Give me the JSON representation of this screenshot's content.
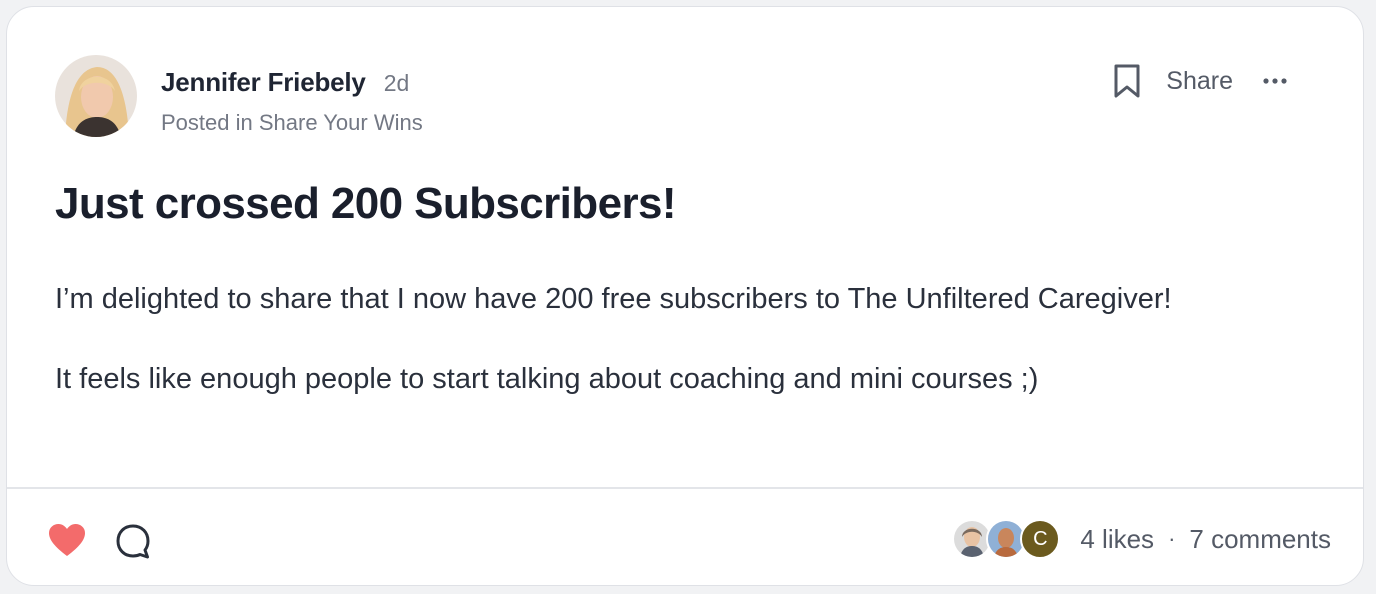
{
  "post": {
    "author_name": "Jennifer Friebely",
    "age": "2d",
    "posted_in_prefix": "Posted in",
    "space_name": "Share Your Wins",
    "share_label": "Share",
    "title": "Just crossed 200 Subscribers!",
    "paragraphs": [
      "I’m delighted to share that I now have 200 free subscribers to The Unfiltered Caregiver!",
      "It feels like enough people to start talking about coaching and mini courses ;)"
    ]
  },
  "footer": {
    "liked": true,
    "likers": [
      {
        "type": "photo",
        "icon": "avatar-photo"
      },
      {
        "type": "photo",
        "icon": "avatar-photo"
      },
      {
        "type": "initial",
        "initial": "C",
        "color": "#6b5a1e"
      }
    ],
    "likes_label": "4 likes",
    "separator": "·",
    "comments_label": "7 comments"
  },
  "icons": {
    "bookmark": "bookmark-icon",
    "more": "more-horizontal-icon",
    "like": "heart-icon",
    "comment": "comment-bubble-icon"
  },
  "colors": {
    "heart": "#f36b6b",
    "text": "#1f2533",
    "muted": "#737884"
  }
}
